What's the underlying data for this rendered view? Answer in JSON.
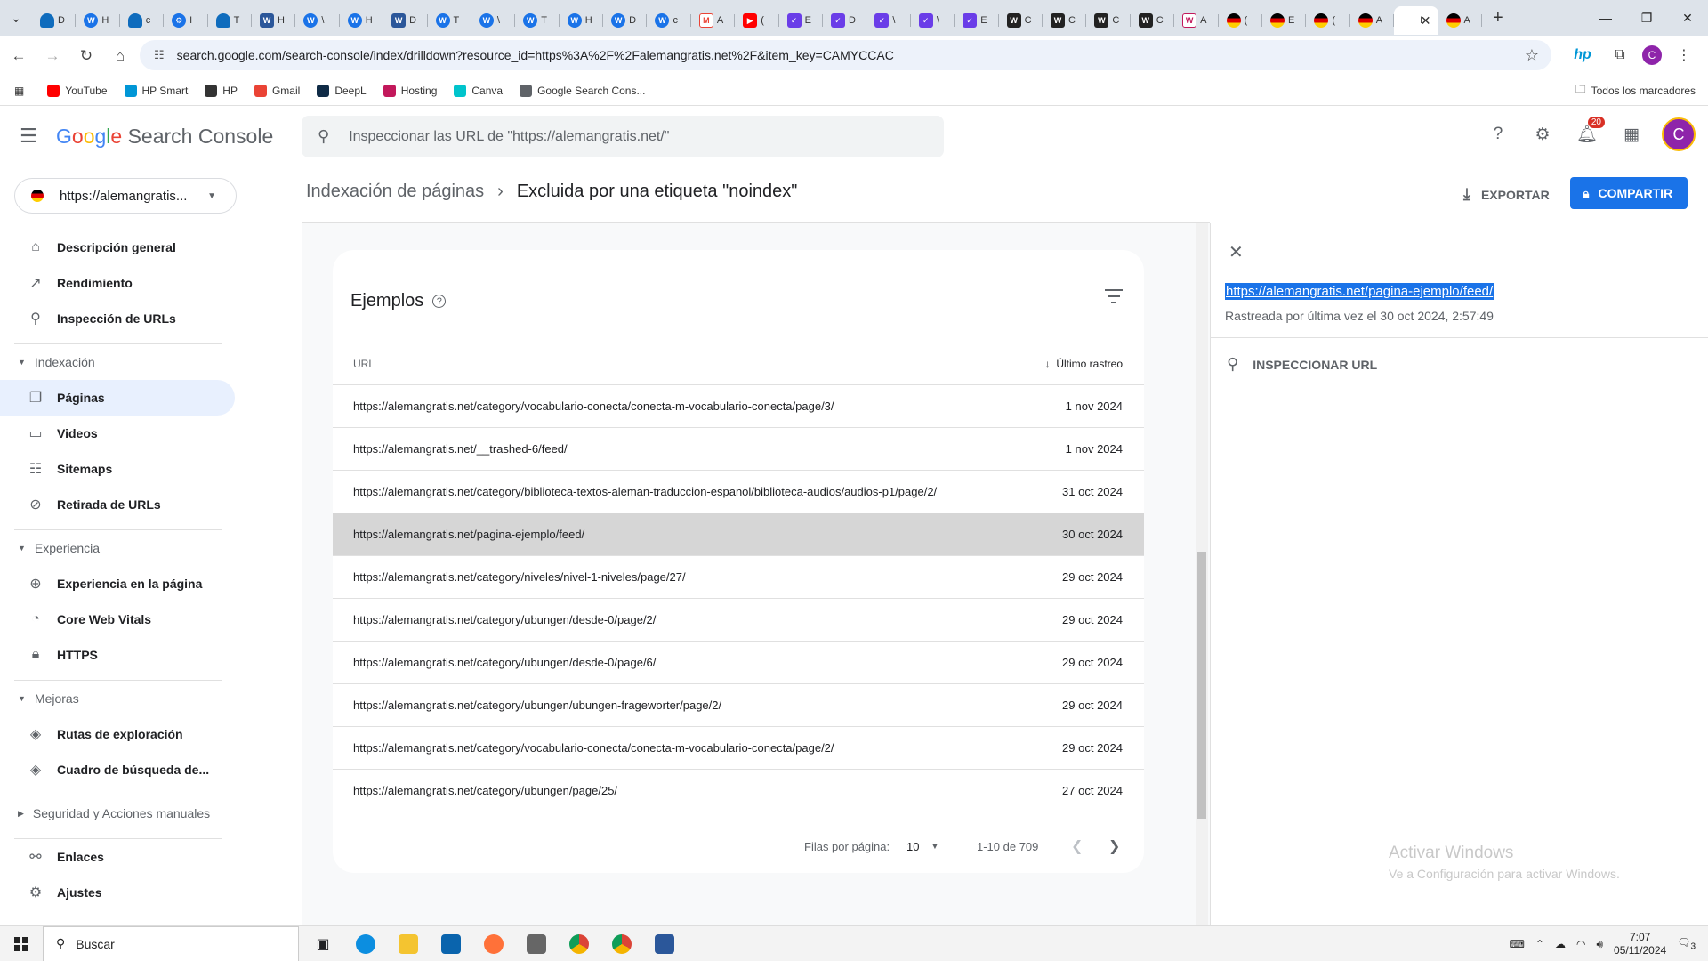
{
  "browser": {
    "tabs": [
      {
        "icon": "onedrive-icon",
        "title": "D"
      },
      {
        "icon": "wordpress-icon",
        "title": "H"
      },
      {
        "icon": "onedrive-icon",
        "title": "c"
      },
      {
        "icon": "settings-icon",
        "title": "I"
      },
      {
        "icon": "onedrive-icon",
        "title": "T"
      },
      {
        "icon": "word-icon",
        "title": "H"
      },
      {
        "icon": "wordpress-icon",
        "title": "\\"
      },
      {
        "icon": "wordpress-icon",
        "title": "H"
      },
      {
        "icon": "word-icon",
        "title": "D"
      },
      {
        "icon": "wordpress-icon",
        "title": "T"
      },
      {
        "icon": "wordpress-icon",
        "title": "\\"
      },
      {
        "icon": "wordpress-icon",
        "title": "T"
      },
      {
        "icon": "wordpress-icon",
        "title": "H"
      },
      {
        "icon": "wordpress-icon",
        "title": "D"
      },
      {
        "icon": "wordpress-icon",
        "title": "c"
      },
      {
        "icon": "gmail-icon",
        "title": "A"
      },
      {
        "icon": "youtube-icon",
        "title": "("
      },
      {
        "icon": "shield-icon",
        "title": "E"
      },
      {
        "icon": "shield-icon",
        "title": "D"
      },
      {
        "icon": "shield-icon",
        "title": "\\"
      },
      {
        "icon": "shield-icon",
        "title": "\\"
      },
      {
        "icon": "shield-icon",
        "title": "E"
      },
      {
        "icon": "w-icon",
        "title": "C"
      },
      {
        "icon": "w-icon",
        "title": "C"
      },
      {
        "icon": "w-icon",
        "title": "C"
      },
      {
        "icon": "w-icon",
        "title": "C"
      },
      {
        "icon": "wp-icon",
        "title": "A"
      },
      {
        "icon": "flag-icon",
        "title": "("
      },
      {
        "icon": "flag-icon",
        "title": "E"
      },
      {
        "icon": "flag-icon",
        "title": "("
      },
      {
        "icon": "flag-icon",
        "title": "A"
      },
      {
        "icon": "active",
        "title": "I"
      },
      {
        "icon": "flag-icon",
        "title": "A"
      }
    ],
    "address": "search.google.com/search-console/index/drilldown?resource_id=https%3A%2F%2Falemangratis.net%2F&item_key=CAMYCCAC",
    "bookmarks": [
      {
        "label": "YouTube",
        "color": "#ff0000"
      },
      {
        "label": "HP Smart",
        "color": "#0096d6"
      },
      {
        "label": "HP",
        "color": "#333333"
      },
      {
        "label": "Gmail",
        "color": "#ea4335"
      },
      {
        "label": "DeepL",
        "color": "#0f2b46"
      },
      {
        "label": "Hosting",
        "color": "#c2185b"
      },
      {
        "label": "Canva",
        "color": "#00c4cc"
      },
      {
        "label": "Google Search Cons...",
        "color": "#5f6368"
      }
    ],
    "all_bookmarks": "Todos los marcadores",
    "profile_initial": "C"
  },
  "app": {
    "logo": {
      "g": "G",
      "o1": "o",
      "o2": "o",
      "g2": "g",
      "l": "l",
      "e": "e",
      "rest": " Search Console"
    },
    "search_placeholder": "Inspeccionar las URL de \"https://alemangratis.net/\"",
    "notifications": "20",
    "avatar_initial": "C",
    "property": "https://alemangratis...",
    "nav": {
      "overview": "Descripción general",
      "performance": "Rendimiento",
      "url_inspection": "Inspección de URLs",
      "group_indexing": "Indexación",
      "pages": "Páginas",
      "videos": "Videos",
      "sitemaps": "Sitemaps",
      "removals": "Retirada de URLs",
      "group_experience": "Experiencia",
      "page_experience": "Experiencia en la página",
      "cwv": "Core Web Vitals",
      "https": "HTTPS",
      "group_enhancements": "Mejoras",
      "breadcrumbs": "Rutas de exploración",
      "sitelinks": "Cuadro de búsqueda de...",
      "group_security": "Seguridad y Acciones manuales",
      "links": "Enlaces",
      "settings": "Ajustes"
    },
    "breadcrumb": {
      "parent": "Indexación de páginas",
      "current": "Excluida por una etiqueta \"noindex\""
    },
    "export_label": "EXPORTAR",
    "share_label": "COMPARTIR",
    "card": {
      "title": "Ejemplos",
      "col_url": "URL",
      "col_date": "Último rastreo",
      "rows": [
        {
          "url": "https://alemangratis.net/category/vocabulario-conecta/conecta-m-vocabulario-conecta/page/3/",
          "date": "1 nov 2024"
        },
        {
          "url": "https://alemangratis.net/__trashed-6/feed/",
          "date": "1 nov 2024"
        },
        {
          "url": "https://alemangratis.net/category/biblioteca-textos-aleman-traduccion-espanol/biblioteca-audios/audios-p1/page/2/",
          "date": "31 oct 2024"
        },
        {
          "url": "https://alemangratis.net/pagina-ejemplo/feed/",
          "date": "30 oct 2024"
        },
        {
          "url": "https://alemangratis.net/category/niveles/nivel-1-niveles/page/27/",
          "date": "29 oct 2024"
        },
        {
          "url": "https://alemangratis.net/category/ubungen/desde-0/page/2/",
          "date": "29 oct 2024"
        },
        {
          "url": "https://alemangratis.net/category/ubungen/desde-0/page/6/",
          "date": "29 oct 2024"
        },
        {
          "url": "https://alemangratis.net/category/ubungen/ubungen-frageworter/page/2/",
          "date": "29 oct 2024"
        },
        {
          "url": "https://alemangratis.net/category/vocabulario-conecta/conecta-m-vocabulario-conecta/page/2/",
          "date": "29 oct 2024"
        },
        {
          "url": "https://alemangratis.net/category/ubungen/page/25/",
          "date": "27 oct 2024"
        }
      ],
      "rows_per_page_label": "Filas por página:",
      "rows_per_page": "10",
      "range": "1-10 de 709"
    },
    "panel": {
      "url": "https://alemangratis.net/pagina-ejemplo/feed/",
      "subtitle": "Rastreada por última vez el 30 oct 2024, 2:57:49",
      "action": "INSPECCIONAR URL"
    },
    "watermark": {
      "title": "Activar Windows",
      "subtitle": "Ve a Configuración para activar Windows."
    }
  },
  "taskbar": {
    "search": "Buscar",
    "time": "7:07",
    "date": "05/11/2024",
    "notif_count": "3"
  }
}
